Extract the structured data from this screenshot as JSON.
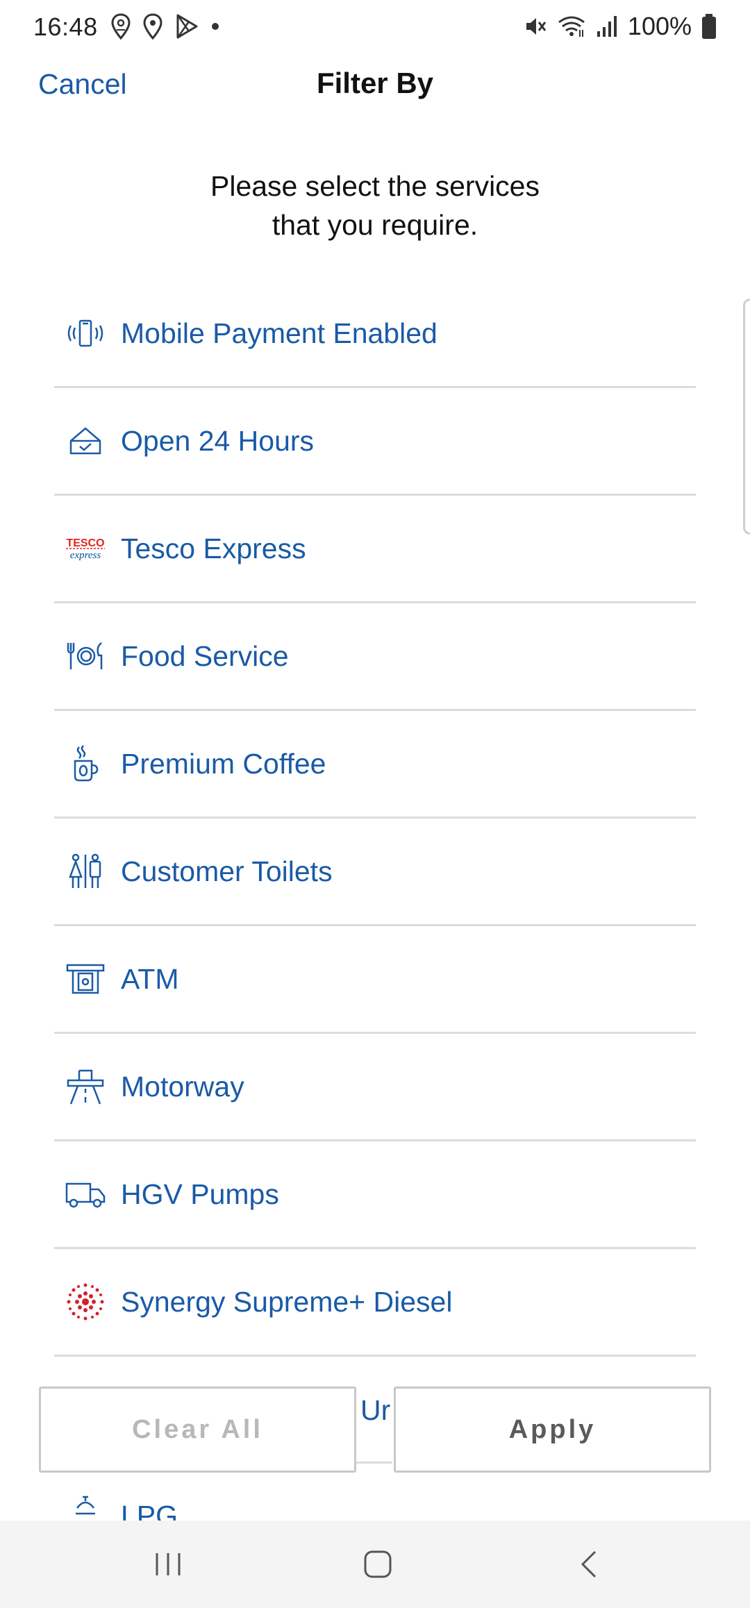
{
  "status_bar": {
    "time": "16:48",
    "battery": "100%",
    "left_icons": [
      "location-pin-outline-icon",
      "location-pin-icon",
      "play-store-icon",
      "dot-icon"
    ],
    "right_icons": [
      "mute-icon",
      "wifi-icon",
      "signal-icon",
      "battery-icon"
    ]
  },
  "header": {
    "cancel_label": "Cancel",
    "title": "Filter By"
  },
  "subtitle_line1": "Please select the services",
  "subtitle_line2": "that you require.",
  "services": [
    {
      "label": "Mobile Payment Enabled",
      "icon": "mobile-payment-icon"
    },
    {
      "label": "Open 24 Hours",
      "icon": "open-24-hours-icon"
    },
    {
      "label": "Tesco Express",
      "icon": "tesco-express-logo"
    },
    {
      "label": "Food Service",
      "icon": "food-service-icon"
    },
    {
      "label": "Premium Coffee",
      "icon": "coffee-icon"
    },
    {
      "label": "Customer Toilets",
      "icon": "toilets-icon"
    },
    {
      "label": "ATM",
      "icon": "atm-icon"
    },
    {
      "label": "Motorway",
      "icon": "motorway-icon"
    },
    {
      "label": "HGV Pumps",
      "icon": "truck-icon"
    },
    {
      "label": "Synergy Supreme+ Diesel",
      "icon": "synergy-icon"
    }
  ],
  "partial_item_text": "Ur",
  "partial_item_lpg": "LPG",
  "tesco_logo": {
    "line1": "TESCO",
    "line2": "express"
  },
  "buttons": {
    "clear_all": "Clear All",
    "apply": "Apply"
  },
  "colors": {
    "accent": "#1a5aa6",
    "synergy_red": "#d4202c",
    "tesco_red": "#e2231a",
    "tesco_blue": "#00539f"
  },
  "nav_bar": {
    "icons": [
      "recent-apps-icon",
      "home-icon",
      "back-icon"
    ]
  }
}
